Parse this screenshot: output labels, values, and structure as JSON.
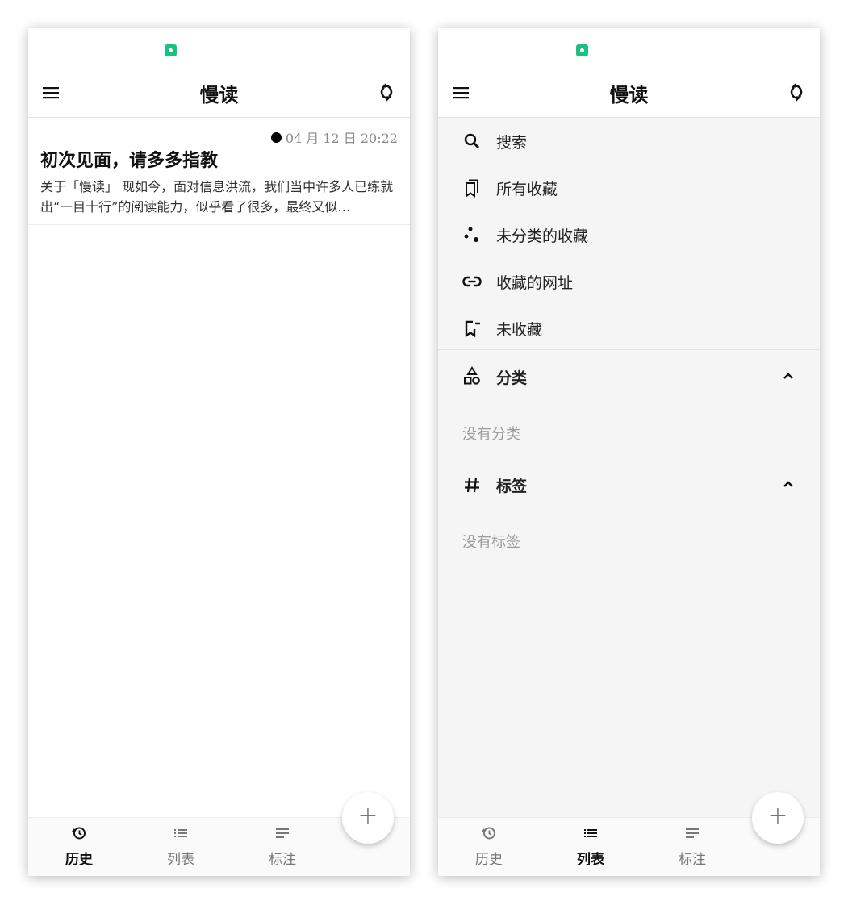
{
  "left_screen": {
    "app_title": "慢读",
    "article": {
      "time": "04 月 12 日 20:22",
      "title": "初次见面，请多多指教",
      "excerpt": "关于「慢读」 现如今，面对信息洪流，我们当中许多人已练就出“一目十行”的阅读能力，似乎看了很多，最终又似…"
    },
    "nav": [
      {
        "label": "历史",
        "icon": "history-icon",
        "active": true
      },
      {
        "label": "列表",
        "icon": "list-icon",
        "active": false
      },
      {
        "label": "标注",
        "icon": "notes-icon",
        "active": false
      }
    ],
    "fab_label": "+"
  },
  "right_screen": {
    "app_title": "慢读",
    "drawer": {
      "items": [
        {
          "label": "搜索",
          "icon": "search-icon"
        },
        {
          "label": "所有收藏",
          "icon": "bookmark-icon"
        },
        {
          "label": "未分类的收藏",
          "icon": "scatter-dots-icon"
        },
        {
          "label": "收藏的网址",
          "icon": "link-icon"
        },
        {
          "label": "未收藏",
          "icon": "bookmark-remove-icon"
        }
      ],
      "categories": {
        "label": "分类",
        "icon": "shapes-icon",
        "empty": "没有分类"
      },
      "tags": {
        "label": "标签",
        "icon": "hash-icon",
        "empty": "没有标签"
      }
    },
    "nav": [
      {
        "label": "历史",
        "icon": "history-icon",
        "active": false
      },
      {
        "label": "列表",
        "icon": "list-icon",
        "active": true
      },
      {
        "label": "标注",
        "icon": "notes-icon",
        "active": false
      }
    ],
    "fab_label": "+"
  },
  "colors": {
    "status_icon": "#19c37d",
    "accent_text": "#111111",
    "muted_text": "#9a9a9a"
  }
}
